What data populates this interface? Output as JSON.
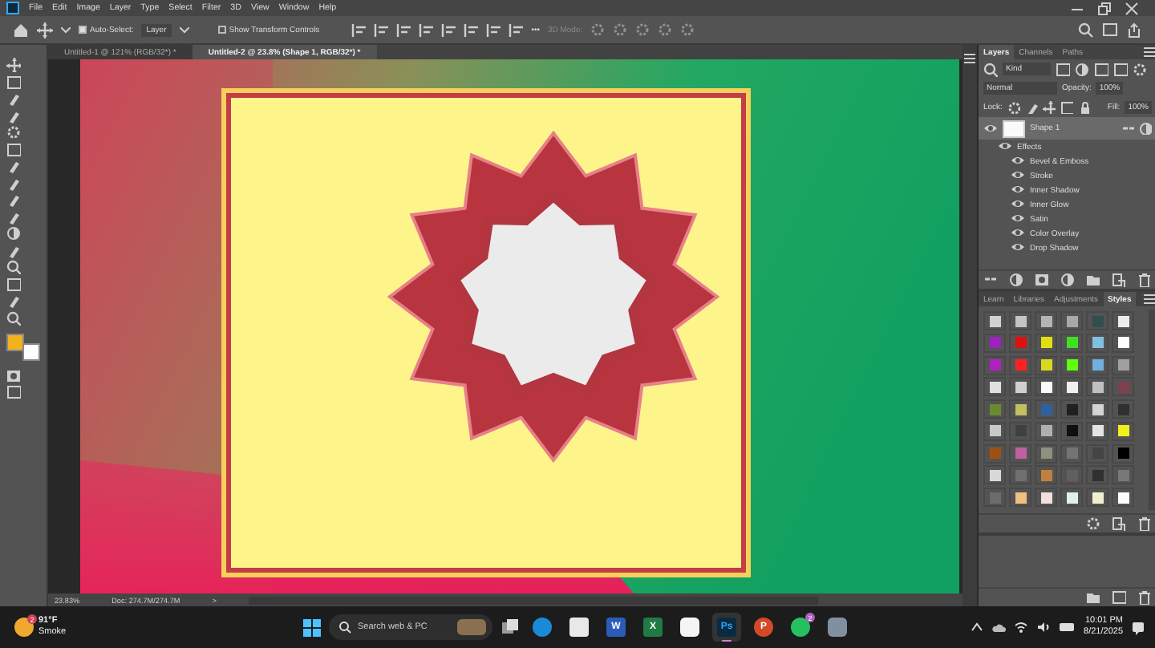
{
  "menu": [
    "File",
    "Edit",
    "Image",
    "Layer",
    "Type",
    "Select",
    "Filter",
    "3D",
    "View",
    "Window",
    "Help"
  ],
  "options": {
    "auto_select": {
      "label": "Auto-Select:",
      "checked": true
    },
    "target": "Layer",
    "transform_controls": {
      "label": "Show Transform Controls",
      "checked": false
    },
    "more": "•••",
    "mode_3d": "3D Mode:"
  },
  "doc_tabs": [
    {
      "label": "Untitled-1 @ 121% (RGB/32*) *",
      "selected": false
    },
    {
      "label": "Untitled-2 @ 23.8% (Shape 1, RGB/32*) *",
      "selected": true
    }
  ],
  "toolbar": {
    "swatches": [
      {
        "color": "#f2b21c"
      },
      {
        "color": "#ffffff"
      }
    ]
  },
  "status": {
    "zoom": "23.83%",
    "doc": "Doc: 274.7M/274.7M",
    "arrow": ">"
  },
  "layers_panel": {
    "tabs": [
      {
        "label": "Layers",
        "selected": true
      },
      {
        "label": "Channels",
        "selected": false
      },
      {
        "label": "Paths",
        "selected": false
      }
    ],
    "filter": "Kind",
    "blend_mode": "Normal",
    "opacity_label": "Opacity:",
    "opacity": "100%",
    "lock_label": "Lock:",
    "fill_label": "Fill:",
    "fill": "100%",
    "layer": {
      "name": "Shape 1",
      "visible": true,
      "selected": true
    },
    "effects_label": "Effects",
    "effects": [
      {
        "name": "Bevel & Emboss",
        "visible": true
      },
      {
        "name": "Stroke",
        "visible": true
      },
      {
        "name": "Inner Shadow",
        "visible": true
      },
      {
        "name": "Inner Glow",
        "visible": true
      },
      {
        "name": "Satin",
        "visible": true
      },
      {
        "name": "Color Overlay",
        "visible": true
      },
      {
        "name": "Drop Shadow",
        "visible": true
      }
    ]
  },
  "styles_panel": {
    "tabs": [
      {
        "label": "Learn",
        "selected": false
      },
      {
        "label": "Libraries",
        "selected": false
      },
      {
        "label": "Adjustments",
        "selected": false
      },
      {
        "label": "Styles",
        "selected": true
      }
    ],
    "swatches": [
      {
        "color": "#d0d0d0"
      },
      {
        "color": "#c4c4c4"
      },
      {
        "color": "#b4b4b4"
      },
      {
        "color": "#a8a8a8"
      },
      {
        "color": "#2f4f4f"
      },
      {
        "color": "#ececec"
      },
      {
        "color": "#a020c0"
      },
      {
        "color": "#e01010"
      },
      {
        "color": "#e0e010"
      },
      {
        "color": "#40e020"
      },
      {
        "color": "#80c0e0"
      },
      {
        "color": "#ffffff"
      },
      {
        "color": "#b020c0"
      },
      {
        "color": "#ff2020"
      },
      {
        "color": "#d8d820"
      },
      {
        "color": "#60ff10"
      },
      {
        "color": "#70b0e0"
      },
      {
        "color": "#a0a0a0"
      },
      {
        "color": "#e0e0e0"
      },
      {
        "color": "#d0d0d0"
      },
      {
        "color": "#fafafa"
      },
      {
        "color": "#f0f0f0"
      },
      {
        "color": "#c0c0c0"
      },
      {
        "color": "#804050"
      },
      {
        "color": "#6a8a30"
      },
      {
        "color": "#c0c060"
      },
      {
        "color": "#3060a0"
      },
      {
        "color": "#202020"
      },
      {
        "color": "#d4d4d4"
      },
      {
        "color": "#303030"
      },
      {
        "color": "#c8c8c8"
      },
      {
        "color": "#404040"
      },
      {
        "color": "#b0b0b0"
      },
      {
        "color": "#101010"
      },
      {
        "color": "#e4e4e4"
      },
      {
        "color": "#f0f020"
      },
      {
        "color": "#a05010"
      },
      {
        "color": "#c060a0"
      },
      {
        "color": "#909080"
      },
      {
        "color": "#747474"
      },
      {
        "color": "#444444"
      },
      {
        "color": "#000000"
      },
      {
        "color": "#d8d8d8"
      },
      {
        "color": "#707070"
      },
      {
        "color": "#c08040"
      },
      {
        "color": "#606060"
      },
      {
        "color": "#303030"
      },
      {
        "color": "#787878"
      },
      {
        "color": "#6c6c6c"
      },
      {
        "color": "#f0c080"
      },
      {
        "color": "#f0e0e0"
      },
      {
        "color": "#e0f0f0"
      },
      {
        "color": "#f0f0d0"
      },
      {
        "color": "#fdfdfd"
      }
    ]
  },
  "taskbar": {
    "weather": {
      "temp": "91°F",
      "condition": "Smoke",
      "badge": "2"
    },
    "search_placeholder": "Search web & PC",
    "apps": [
      {
        "kind": "edge",
        "active": false
      },
      {
        "kind": "store",
        "active": false
      },
      {
        "kind": "word",
        "label": "W",
        "active": false
      },
      {
        "kind": "excel",
        "label": "X",
        "active": false
      },
      {
        "kind": "chat",
        "active": false
      },
      {
        "kind": "photoshop",
        "label": "Ps",
        "active": true
      },
      {
        "kind": "powerpoint",
        "label": "P",
        "active": false
      },
      {
        "kind": "whatsapp",
        "badge": "2",
        "active": false
      },
      {
        "kind": "camera",
        "active": false
      }
    ],
    "time": "10:01 PM",
    "date": "8/21/2025"
  }
}
